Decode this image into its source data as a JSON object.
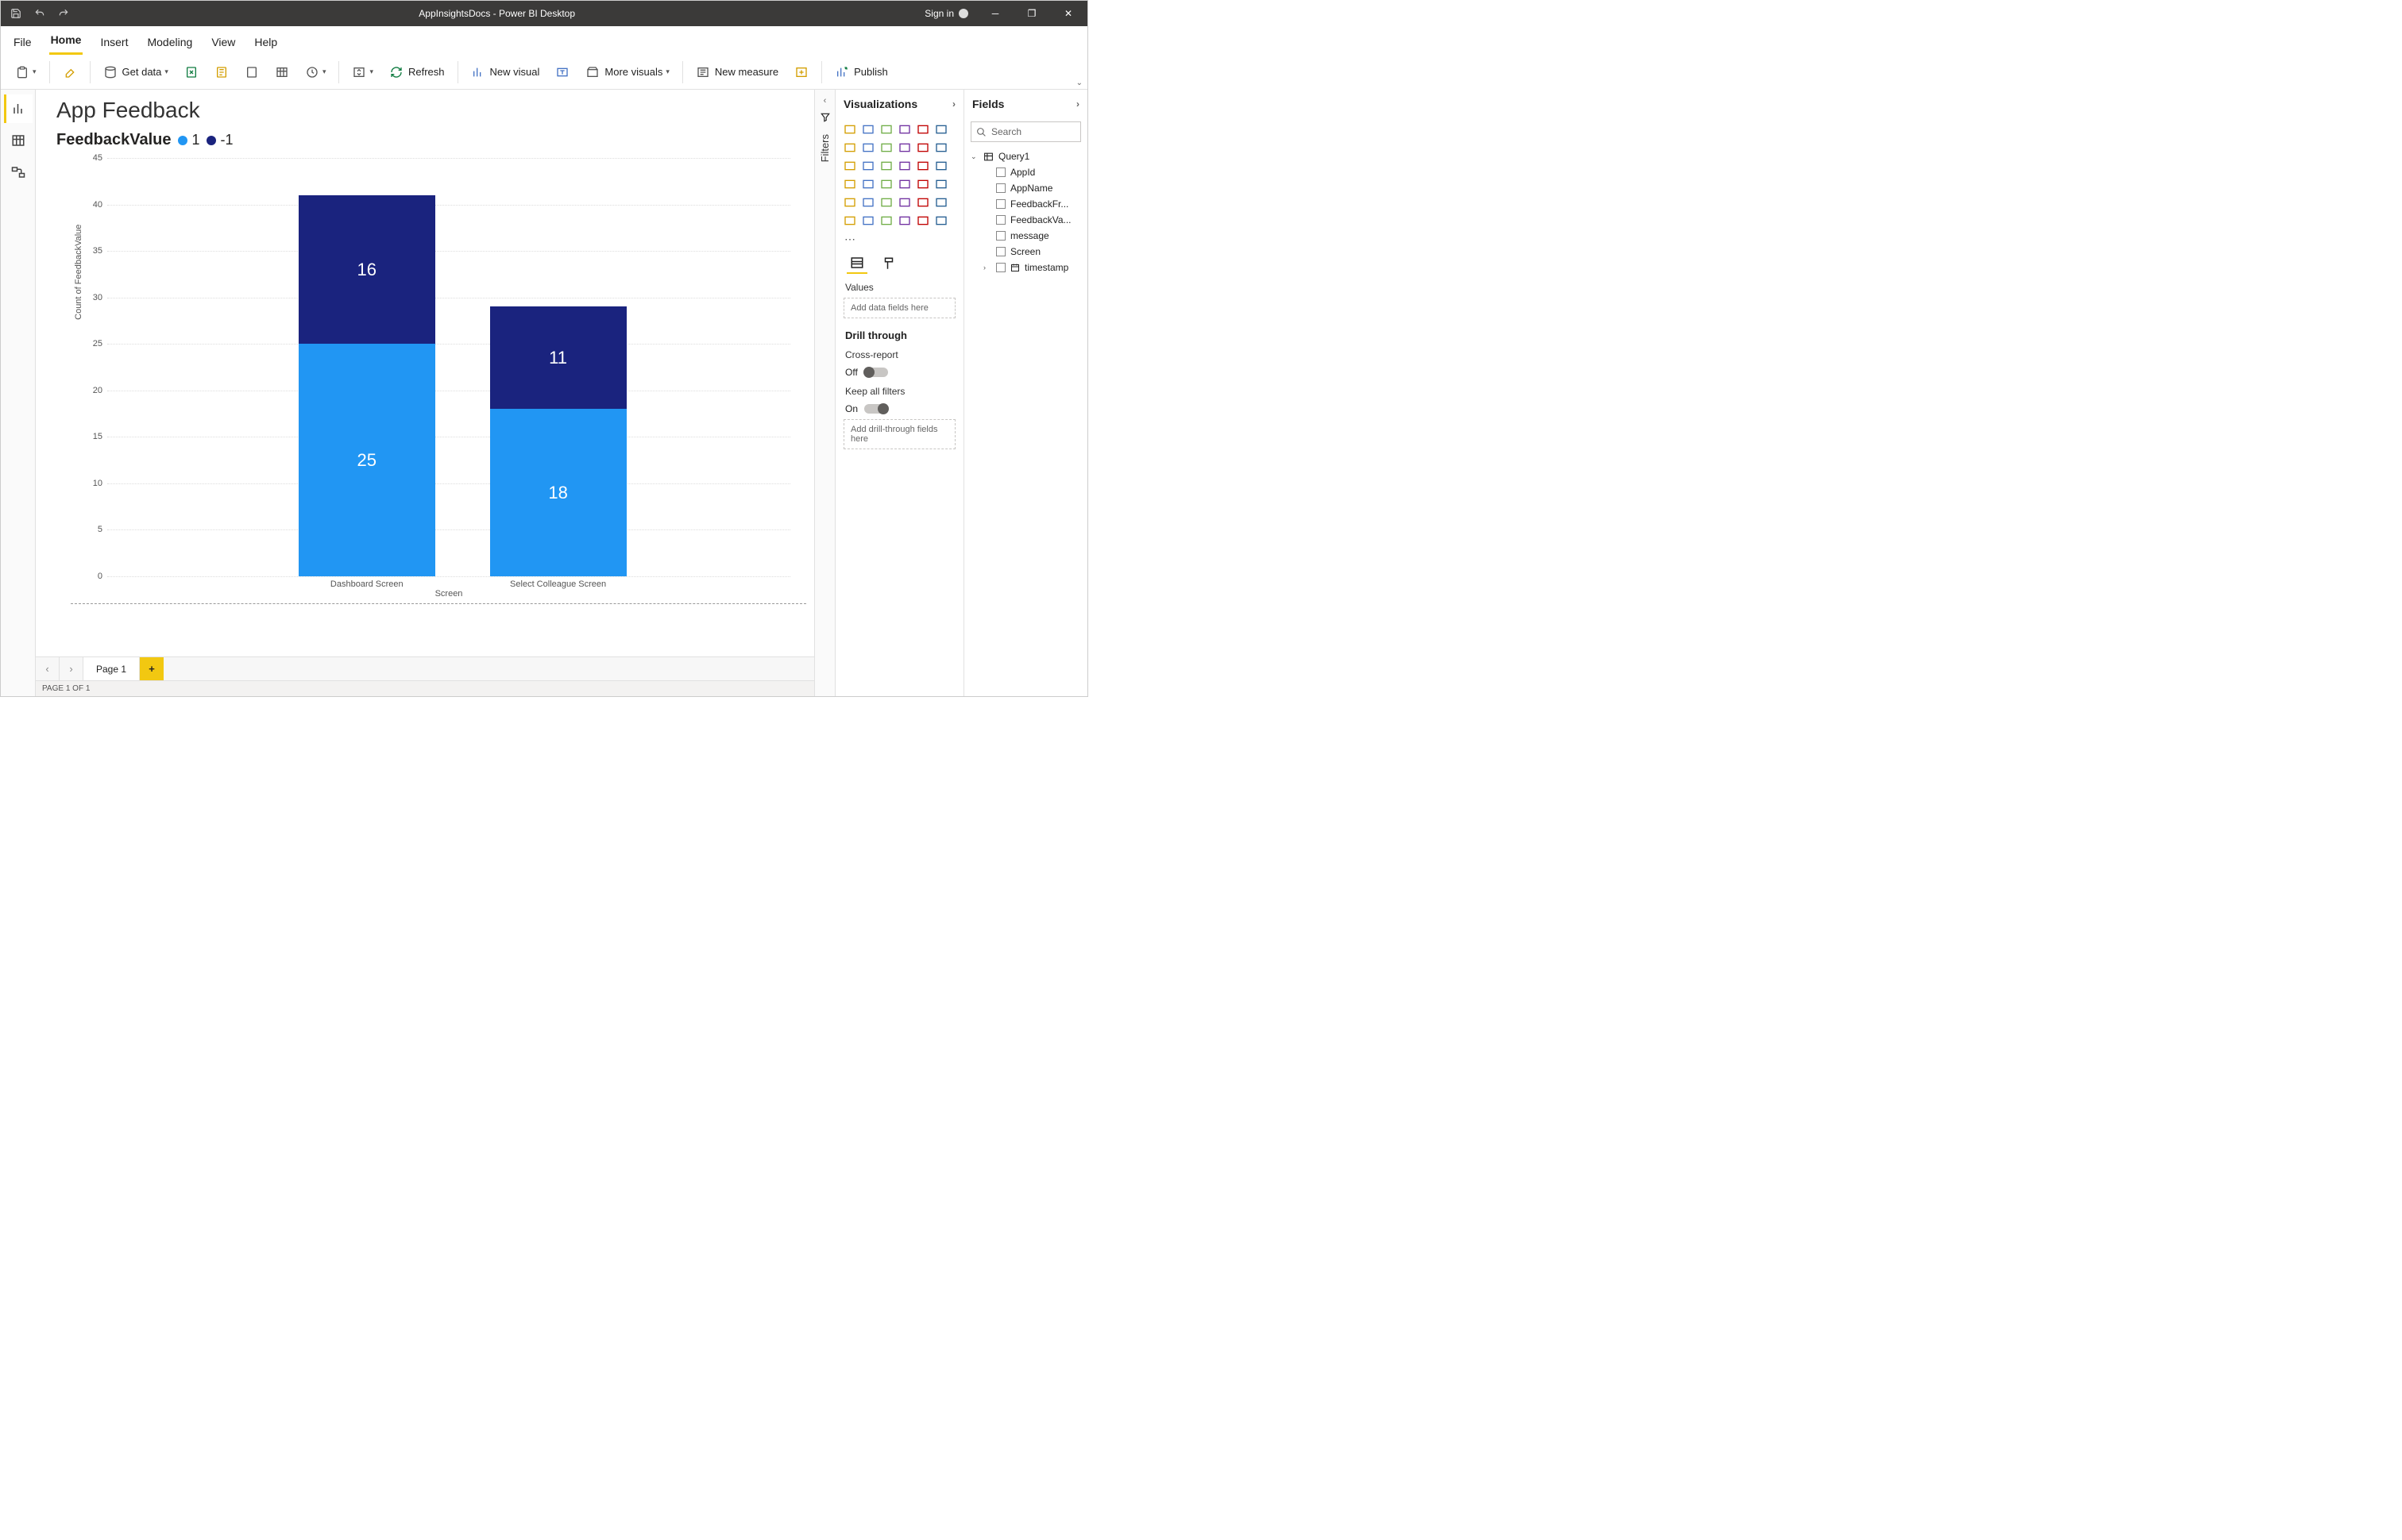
{
  "window": {
    "title": "AppInsightsDocs - Power BI Desktop",
    "signin": "Sign in"
  },
  "menutabs": [
    "File",
    "Home",
    "Insert",
    "Modeling",
    "View",
    "Help"
  ],
  "active_tab": "Home",
  "ribbon": {
    "get_data": "Get data",
    "refresh": "Refresh",
    "new_visual": "New visual",
    "more_visuals": "More visuals",
    "new_measure": "New measure",
    "publish": "Publish"
  },
  "report": {
    "title": "App Feedback",
    "legend_title": "FeedbackValue",
    "legend": [
      {
        "label": "1",
        "color": "#2196f3"
      },
      {
        "label": "-1",
        "color": "#1a237e"
      }
    ]
  },
  "chart_data": {
    "type": "bar",
    "stacked": true,
    "title": "FeedbackValue",
    "xlabel": "Screen",
    "ylabel": "Count of FeedbackValue",
    "categories": [
      "Dashboard Screen",
      "Select Colleague Screen"
    ],
    "series": [
      {
        "name": "1",
        "color": "#2196f3",
        "values": [
          25,
          18
        ]
      },
      {
        "name": "-1",
        "color": "#1a237e",
        "values": [
          16,
          11
        ]
      }
    ],
    "ylim": [
      0,
      45
    ],
    "ytick_step": 5
  },
  "filters_label": "Filters",
  "viz": {
    "header": "Visualizations",
    "values_label": "Values",
    "values_placeholder": "Add data fields here",
    "drill_header": "Drill through",
    "cross_report_label": "Cross-report",
    "cross_report_value": "Off",
    "keep_filters_label": "Keep all filters",
    "keep_filters_value": "On",
    "drill_placeholder": "Add drill-through fields here"
  },
  "fields": {
    "header": "Fields",
    "search_placeholder": "Search",
    "table": "Query1",
    "columns": [
      "AppId",
      "AppName",
      "FeedbackFr...",
      "FeedbackVa...",
      "message",
      "Screen",
      "timestamp"
    ]
  },
  "pages": {
    "tab": "Page 1",
    "status": "PAGE 1 OF 1"
  }
}
